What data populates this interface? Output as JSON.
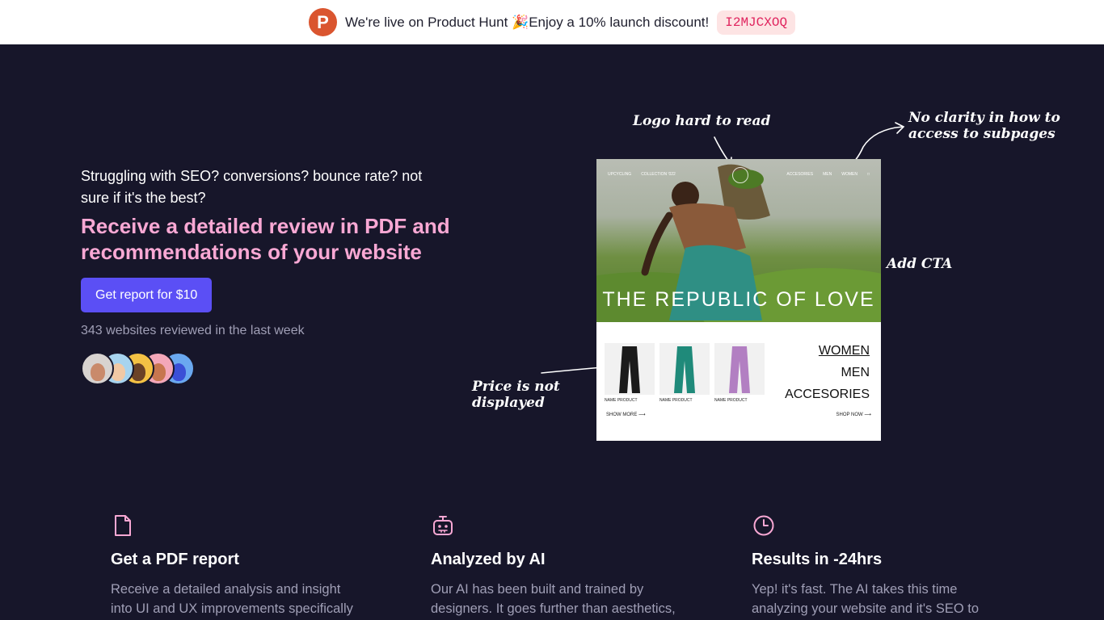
{
  "announcement": {
    "text": "We're live on Product Hunt 🎉Enjoy a 10% launch discount!",
    "coupon": "I2MJCXOQ"
  },
  "hero": {
    "lead": "Struggling with SEO? conversions?  bounce rate? not sure if it's the best?",
    "title": "Receive a detailed review in PDF and recommendations of your website",
    "cta_label": "Get report for $10",
    "reviewed": "343 websites reviewed in the last week"
  },
  "annotations": {
    "logo": "Logo hard to read",
    "clarity": "No clarity in how to access to subpages",
    "cta": "Add CTA",
    "price": "Price is not displayed"
  },
  "mockup": {
    "nav_left": [
      "UPCYCLING",
      "COLLECTION '022"
    ],
    "nav_right": [
      "ACCESORIES",
      "MEN",
      "WOMEN"
    ],
    "hero_text": "THE REPUBLIC OF LOVE",
    "products": [
      {
        "name": "NAME PRODUCT",
        "color": "#1b1b1b"
      },
      {
        "name": "NAME PRODUCT",
        "color": "#1f8a7a"
      },
      {
        "name": "NAME PRODUCT",
        "color": "#b27fc2"
      }
    ],
    "show_more": "SHOW MORE",
    "shop_now": "SHOP NOW",
    "categories": [
      "WOMEN",
      "MEN",
      "ACCESORIES"
    ]
  },
  "avatars": [
    {
      "bg": "#d8d3d0",
      "face": "#c98a6b"
    },
    {
      "bg": "#a7d4ef",
      "face": "#f1c9a5"
    },
    {
      "bg": "#f4c244",
      "face": "#6b4226"
    },
    {
      "bg": "#f4a7b9",
      "face": "#c7764f"
    },
    {
      "bg": "#6aa8f0",
      "face": "#3b4fd6"
    }
  ],
  "features": [
    {
      "icon": "document-icon",
      "title": "Get a PDF report",
      "text": "Receive a detailed analysis and insight into UI and UX improvements specifically to help your website get"
    },
    {
      "icon": "robot-icon",
      "title": "Analyzed by AI",
      "text": "Our AI has been built and trained by designers. It goes further than aesthetics, it focuses on how to"
    },
    {
      "icon": "clock-icon",
      "title": "Results in -24hrs",
      "text": "Yep! it's fast. The AI takes this time analyzing your website and it's SEO to give you the best review, as well as a"
    }
  ],
  "colors": {
    "background": "#17162a",
    "accent": "#5b4ff5",
    "title_pink": "#f9a8d4",
    "muted": "#a09fb6",
    "icon_pink": "#f9a8d4"
  }
}
